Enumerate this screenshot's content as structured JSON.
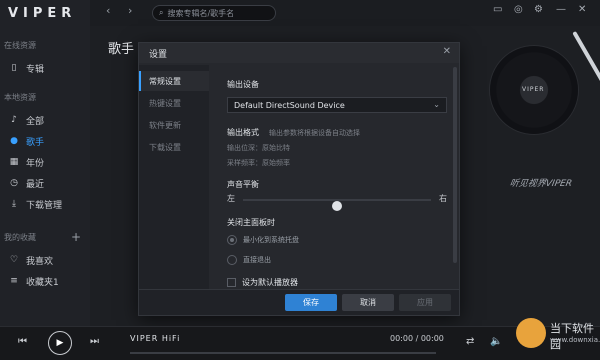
{
  "app": {
    "logo": "VIPER"
  },
  "sidebar": {
    "online_title": "在线资源",
    "online_items": [
      {
        "label": "专辑",
        "icon": "bookmark-icon"
      }
    ],
    "local_title": "本地资源",
    "local_items": [
      {
        "label": "全部",
        "icon": "music-note-icon"
      },
      {
        "label": "歌手",
        "icon": "user-icon",
        "active": true
      },
      {
        "label": "年份",
        "icon": "calendar-icon"
      },
      {
        "label": "最近",
        "icon": "clock-icon"
      },
      {
        "label": "下载管理",
        "icon": "download-icon"
      }
    ],
    "collection_title": "我的收藏",
    "collection_items": [
      {
        "label": "我喜欢",
        "icon": "heart-icon"
      },
      {
        "label": "收藏夹1",
        "icon": "list-icon"
      }
    ]
  },
  "topbar": {
    "search_placeholder": "搜索专辑名/歌手名",
    "search_icon": "search-icon",
    "right_icons": [
      "download-icon",
      "skin-icon",
      "settings-icon",
      "minimize-icon",
      "close-icon"
    ]
  },
  "main": {
    "title": "歌手",
    "record_label": "VIPER",
    "signature": "听见视界VIPER"
  },
  "modal": {
    "title": "设置",
    "tabs": [
      "常规设置",
      "热键设置",
      "软件更新",
      "下载设置"
    ],
    "output_device_label": "输出设备",
    "output_device_value": "Default DirectSound Device",
    "output_format_label": "输出格式",
    "output_format_hint": "输出参数将根据设备自动选择",
    "bit_depth": "输出位深：原始比特",
    "sample_rate": "采样频率：原始频率",
    "balance_label": "声音平衡",
    "balance_left": "左",
    "balance_right": "右",
    "balance_value": 0.5,
    "close_label": "关闭主面板时",
    "close_options": [
      "最小化到系统托盘",
      "直接退出"
    ],
    "close_selected": 0,
    "default_player_label": "设为默认播放器",
    "buttons": {
      "save": "保存",
      "cancel": "取消",
      "apply": "应用"
    }
  },
  "player": {
    "track": "VIPER HiFi",
    "time": "00:00 / 00:00"
  },
  "watermark": {
    "title": "当下软件园",
    "url": "www.downxia.com"
  }
}
